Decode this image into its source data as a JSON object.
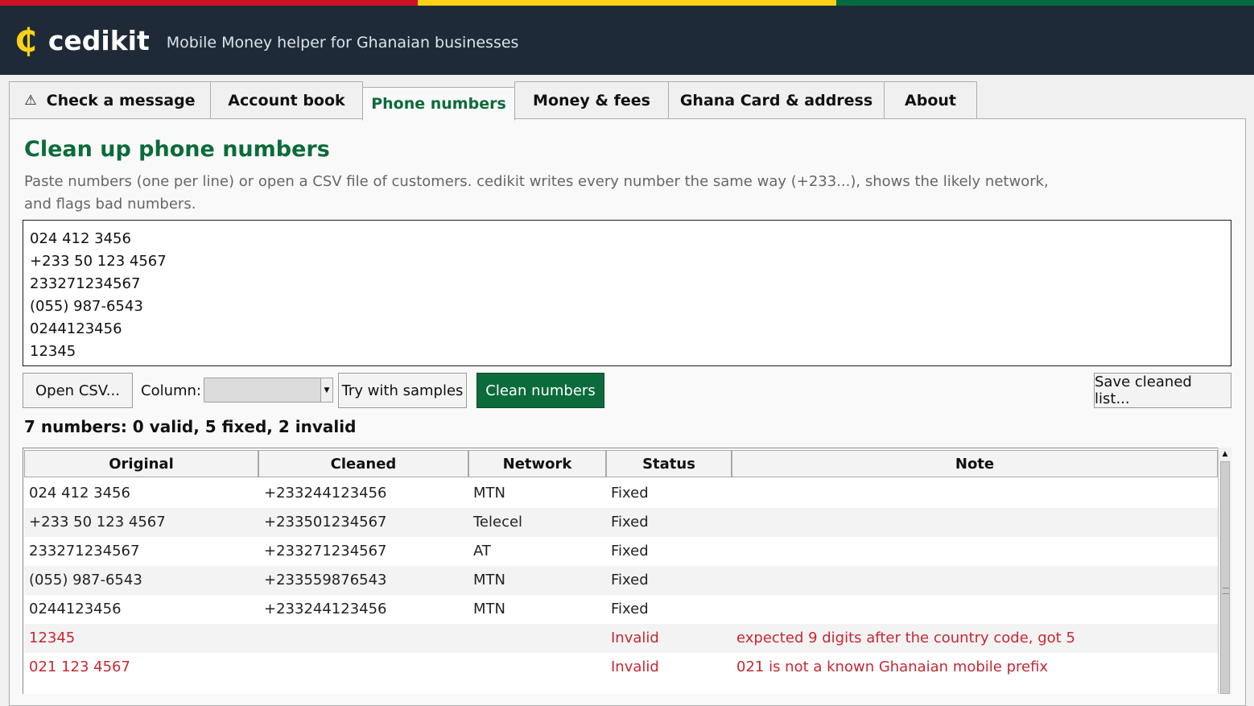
{
  "colors": {
    "flag_red": "#ce1126",
    "flag_gold": "#fcd116",
    "flag_green": "#006b3f",
    "header_bg": "#1f2a38",
    "accent_green": "#0b6b3a",
    "invalid_red": "#c62832"
  },
  "app": {
    "logo_glyph": "₵",
    "name": "cedikit",
    "tagline": "Mobile Money helper for Ghanaian businesses"
  },
  "tabs": [
    {
      "label": "Check a message",
      "icon": "warning-icon",
      "icon_glyph": "⚠",
      "active": false
    },
    {
      "label": "Account book",
      "active": false
    },
    {
      "label": "Phone numbers",
      "active": true
    },
    {
      "label": "Money & fees",
      "active": false
    },
    {
      "label": "Ghana Card & address",
      "active": false
    },
    {
      "label": "About",
      "active": false
    }
  ],
  "phone": {
    "title": "Clean up phone numbers",
    "description": "Paste numbers (one per line) or open a CSV file of customers. cedikit writes every number the same way (+233...), shows the likely network, and flags bad numbers.",
    "input_lines": [
      "024 412 3456",
      "+233 50 123 4567",
      "233271234567",
      "(055) 987-6543",
      "0244123456",
      "12345"
    ],
    "buttons": {
      "open_csv": "Open CSV...",
      "column_label": "Column:",
      "column_value": "",
      "try_samples": "Try with samples",
      "clean": "Clean numbers",
      "save": "Save cleaned list..."
    },
    "summary": "7 numbers: 0 valid, 5 fixed, 2 invalid",
    "table": {
      "headers": [
        "Original",
        "Cleaned",
        "Network",
        "Status",
        "Note"
      ],
      "rows": [
        {
          "original": "024 412 3456",
          "cleaned": "+233244123456",
          "network": "MTN",
          "status": "Fixed",
          "note": ""
        },
        {
          "original": "+233 50 123 4567",
          "cleaned": "+233501234567",
          "network": "Telecel",
          "status": "Fixed",
          "note": ""
        },
        {
          "original": "233271234567",
          "cleaned": "+233271234567",
          "network": "AT",
          "status": "Fixed",
          "note": ""
        },
        {
          "original": "(055) 987-6543",
          "cleaned": "+233559876543",
          "network": "MTN",
          "status": "Fixed",
          "note": ""
        },
        {
          "original": "0244123456",
          "cleaned": "+233244123456",
          "network": "MTN",
          "status": "Fixed",
          "note": ""
        },
        {
          "original": "12345",
          "cleaned": "",
          "network": "",
          "status": "Invalid",
          "note": "expected 9 digits after the country code, got 5"
        },
        {
          "original": "021 123 4567",
          "cleaned": "",
          "network": "",
          "status": "Invalid",
          "note": "021 is not a known Ghanaian mobile prefix"
        }
      ]
    }
  }
}
